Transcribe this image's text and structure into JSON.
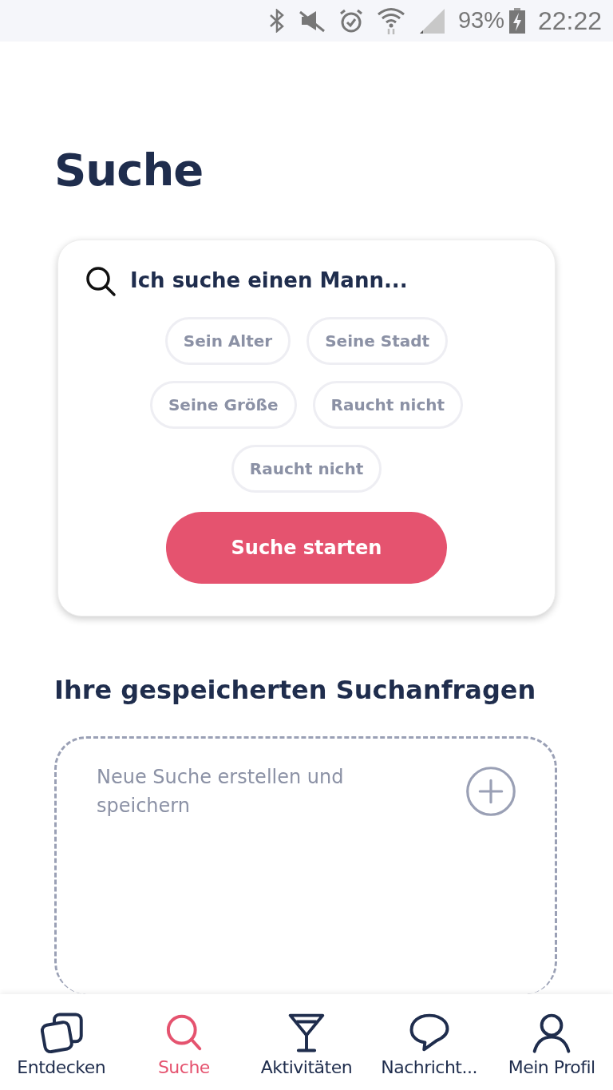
{
  "status_bar": {
    "battery": "93%",
    "time": "22:22"
  },
  "title": "Suche",
  "search_card": {
    "prompt": "Ich suche einen Mann...",
    "filters": [
      {
        "label": "Sein Alter"
      },
      {
        "label": "Seine Stadt"
      },
      {
        "label": "Seine Größe"
      },
      {
        "label": "Raucht nicht"
      },
      {
        "label": "Raucht nicht"
      }
    ],
    "button": "Suche starten"
  },
  "saved": {
    "heading": "Ihre gespeicherten Suchanfragen",
    "new_search": "Neue Suche erstellen und speichern"
  },
  "nav": [
    {
      "kind": "cards",
      "label": "Entdecken",
      "selected": false
    },
    {
      "kind": "search",
      "label": "Suche",
      "selected": true
    },
    {
      "kind": "cocktail",
      "label": "Aktivitäten",
      "selected": false
    },
    {
      "kind": "chat",
      "label": "Nachricht...",
      "selected": false
    },
    {
      "kind": "person",
      "label": "Mein Profil",
      "selected": false
    }
  ]
}
